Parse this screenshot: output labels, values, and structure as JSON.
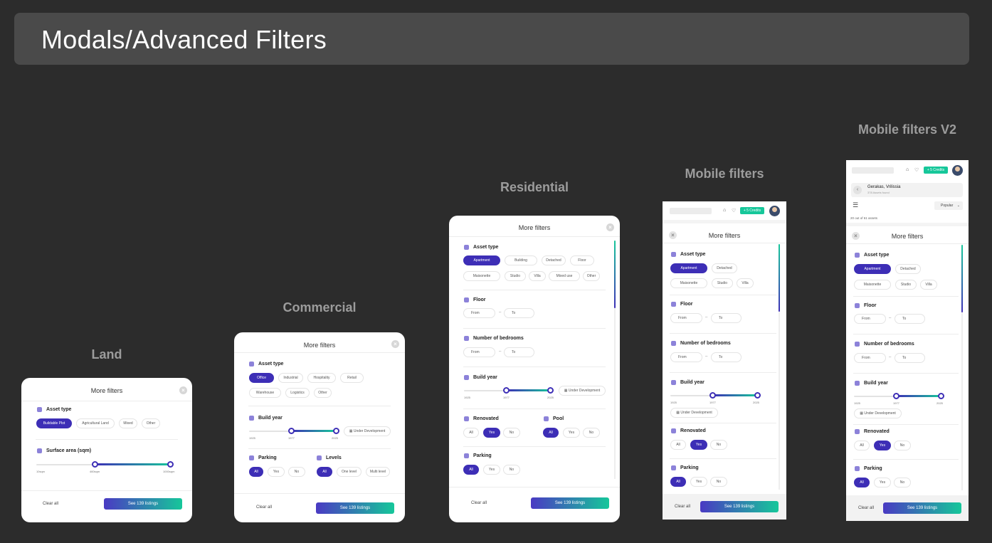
{
  "page_title": "Modals/Advanced Filters",
  "colors": {
    "accent": "#3d2eb6",
    "teal": "#16c79a",
    "background": "#2c2c2c"
  },
  "common": {
    "more_filters": "More filters",
    "clear_all": "Clear all",
    "see_listings": "See 139 listings",
    "from": "From",
    "to": "To",
    "under_development": "Under Development",
    "all": "All",
    "yes": "Yes",
    "no": "No"
  },
  "land": {
    "title": "Land",
    "asset_type": "Asset type",
    "chips": [
      "Buildable Plot",
      "Agricultural Land",
      "Mixed",
      "Other"
    ],
    "surface": "Surface area (sqm)",
    "ticks": [
      "10sqm",
      "460sqm",
      "1000sqm"
    ]
  },
  "commercial": {
    "title": "Commercial",
    "asset_type": "Asset type",
    "chips_row1": [
      "Office",
      "Industrial",
      "Hospitality",
      "Retail"
    ],
    "chips_row2": [
      "Warehouse",
      "Logistics",
      "Other"
    ],
    "build_year": "Build year",
    "ticks": [
      "1925",
      "1977",
      "2025"
    ],
    "parking": "Parking",
    "levels": "Levels",
    "levels_chips": [
      "All",
      "One level",
      "Multi level"
    ]
  },
  "residential": {
    "title": "Residential",
    "asset_type": "Asset type",
    "chips_row1": [
      "Apartment",
      "Building",
      "Detached",
      "Floor"
    ],
    "chips_row2": [
      "Maisonette",
      "Studio",
      "Villa",
      "Mixed use",
      "Other"
    ],
    "floor": "Floor",
    "bedrooms": "Number of bedrooms",
    "build_year": "Build year",
    "ticks": [
      "1925",
      "1977",
      "2025"
    ],
    "renovated": "Renovated",
    "pool": "Pool",
    "parking": "Parking"
  },
  "mobile": {
    "title": "Mobile filters",
    "credits": "+ 5 Credits",
    "asset_type": "Asset type",
    "chips_row1": [
      "Apartment",
      "Detached"
    ],
    "chips_row2": [
      "Maisonette",
      "Studio",
      "Villa"
    ],
    "floor": "Floor",
    "bedrooms": "Number of bedrooms",
    "build_year": "Build year",
    "ticks": [
      "1925",
      "1977",
      "2025"
    ],
    "renovated": "Renovated",
    "parking": "Parking"
  },
  "mobile_v2": {
    "title": "Mobile filters V2",
    "credits": "+ 5 Credits",
    "location": "Gerakas, Vrilissia",
    "assets_found": "378 Assets found",
    "sort": "Popular",
    "count": "20 out of 61 assets",
    "asset_type": "Asset type",
    "chips_row1": [
      "Apartment",
      "Detached"
    ],
    "chips_row2": [
      "Maisonette",
      "Studio",
      "Villa"
    ],
    "floor": "Floor",
    "bedrooms": "Number of bedrooms",
    "build_year": "Build year",
    "ticks": [
      "1925",
      "1977",
      "2025"
    ],
    "renovated": "Renovated",
    "parking": "Parking"
  }
}
